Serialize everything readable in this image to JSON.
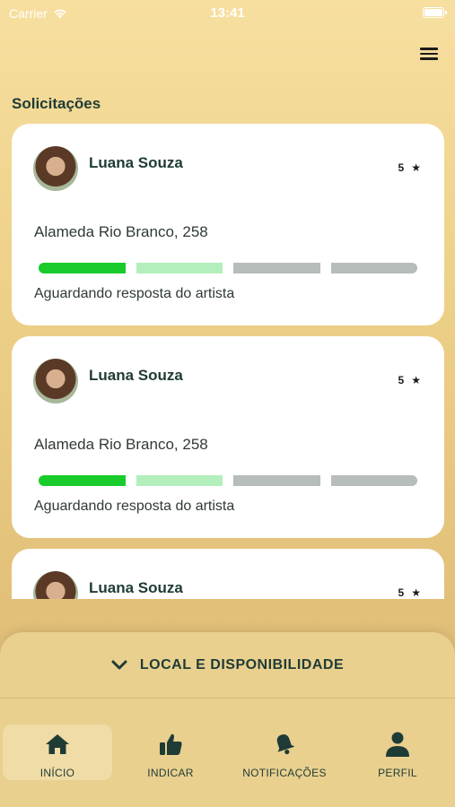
{
  "status_bar": {
    "carrier": "Carrier",
    "time": "13:41"
  },
  "section_title": "Solicitações",
  "cards": [
    {
      "name": "Luana Souza",
      "rating": "5",
      "address": "Alameda Rio Branco, 258",
      "status": "Aguardando resposta do artista",
      "progress_steps_done": 1,
      "progress_steps_total": 4
    },
    {
      "name": "Luana Souza",
      "rating": "5",
      "address": "Alameda Rio Branco, 258",
      "status": "Aguardando resposta do artista",
      "progress_steps_done": 1,
      "progress_steps_total": 4
    },
    {
      "name": "Luana Souza",
      "rating": "5",
      "address": "",
      "status": ""
    }
  ],
  "progress_colors": [
    "#19cc2b",
    "#b3efbd",
    "#b6bdba",
    "#b6bdba"
  ],
  "panel": {
    "title": "LOCAL E DISPONIBILIDADE",
    "icon": "chevron-down-icon"
  },
  "tabs": [
    {
      "label": "INÍCIO",
      "icon": "home-icon",
      "active": true
    },
    {
      "label": "INDICAR",
      "icon": "thumbs-up-icon",
      "active": false
    },
    {
      "label": "NOTIFICAÇÕES",
      "icon": "bell-icon",
      "active": false
    },
    {
      "label": "PERFIL",
      "icon": "user-icon",
      "active": false
    }
  ],
  "colors": {
    "text_primary": "#1f3b35",
    "panel_bg": "#e9d08f",
    "active_tab_bg": "#f0dca6"
  }
}
